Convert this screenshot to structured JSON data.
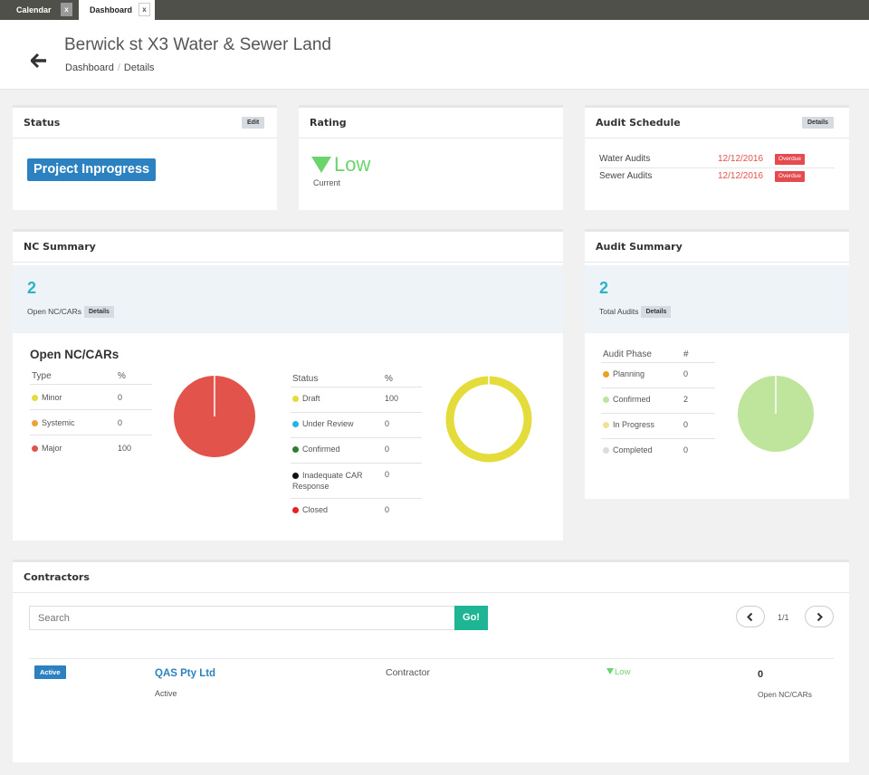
{
  "tabs": [
    {
      "label": "Calendar",
      "close": "x"
    },
    {
      "label": "Dashboard",
      "close": "x"
    }
  ],
  "header": {
    "title": "Berwick st X3 Water & Sewer Land",
    "breadcrumb": [
      "Dashboard",
      "/",
      "Details"
    ]
  },
  "status_card": {
    "title": "Status",
    "edit_label": "Edit",
    "value": "Project Inprogress",
    "badge_color": "#2c82c1"
  },
  "rating_card": {
    "title": "Rating",
    "value": "Low",
    "sub": "Current",
    "color": "#6cd46c"
  },
  "audit_schedule": {
    "title": "Audit Schedule",
    "details_label": "Details",
    "rows": [
      {
        "name": "Water Audits",
        "date": "12/12/2016",
        "badge": "Overdue"
      },
      {
        "name": "Sewer Audits",
        "date": "12/12/2016",
        "badge": "Overdue"
      }
    ]
  },
  "nc_summary": {
    "title": "NC Summary",
    "count": "2",
    "count_label": "Open NC/CARs",
    "details_label": "Details",
    "section_title": "Open NC/CARs",
    "type_table": {
      "headers": [
        "Type",
        "%"
      ],
      "rows": [
        {
          "label": "Minor",
          "value": "0",
          "color": "#e3dc3b"
        },
        {
          "label": "Systemic",
          "value": "0",
          "color": "#efa239"
        },
        {
          "label": "Major",
          "value": "100",
          "color": "#e2534b"
        }
      ]
    },
    "status_table": {
      "headers": [
        "Status",
        "%"
      ],
      "rows": [
        {
          "label": "Draft",
          "value": "100",
          "color": "#e3dc3b"
        },
        {
          "label": "Under Review",
          "value": "0",
          "color": "#22b5e6"
        },
        {
          "label": "Confirmed",
          "value": "0",
          "color": "#2e7d32"
        },
        {
          "label": "Inadequate CAR Response",
          "value": "0",
          "color": "#111111"
        },
        {
          "label": "Closed",
          "value": "0",
          "color": "#e52222"
        }
      ]
    }
  },
  "audit_summary": {
    "title": "Audit Summary",
    "count": "2",
    "count_label": "Total Audits",
    "details_label": "Details",
    "table": {
      "headers": [
        "Audit Phase",
        "#"
      ],
      "rows": [
        {
          "label": "Planning",
          "value": "0",
          "color": "#f0a021"
        },
        {
          "label": "Confirmed",
          "value": "2",
          "color": "#bfe49b"
        },
        {
          "label": "In Progress",
          "value": "0",
          "color": "#efe19a"
        },
        {
          "label": "Completed",
          "value": "0",
          "color": "#dcdcdc"
        }
      ]
    }
  },
  "contractors": {
    "title": "Contractors",
    "search_placeholder": "Search",
    "search_value": "",
    "go_label": "Go!",
    "pager": "1/1",
    "rows": [
      {
        "status_badge": "Active",
        "name": "QAS Pty Ltd",
        "sub": "Active",
        "type": "Contractor",
        "rating": "Low",
        "open_count": "0",
        "open_label": "Open NC/CARs"
      }
    ]
  }
}
